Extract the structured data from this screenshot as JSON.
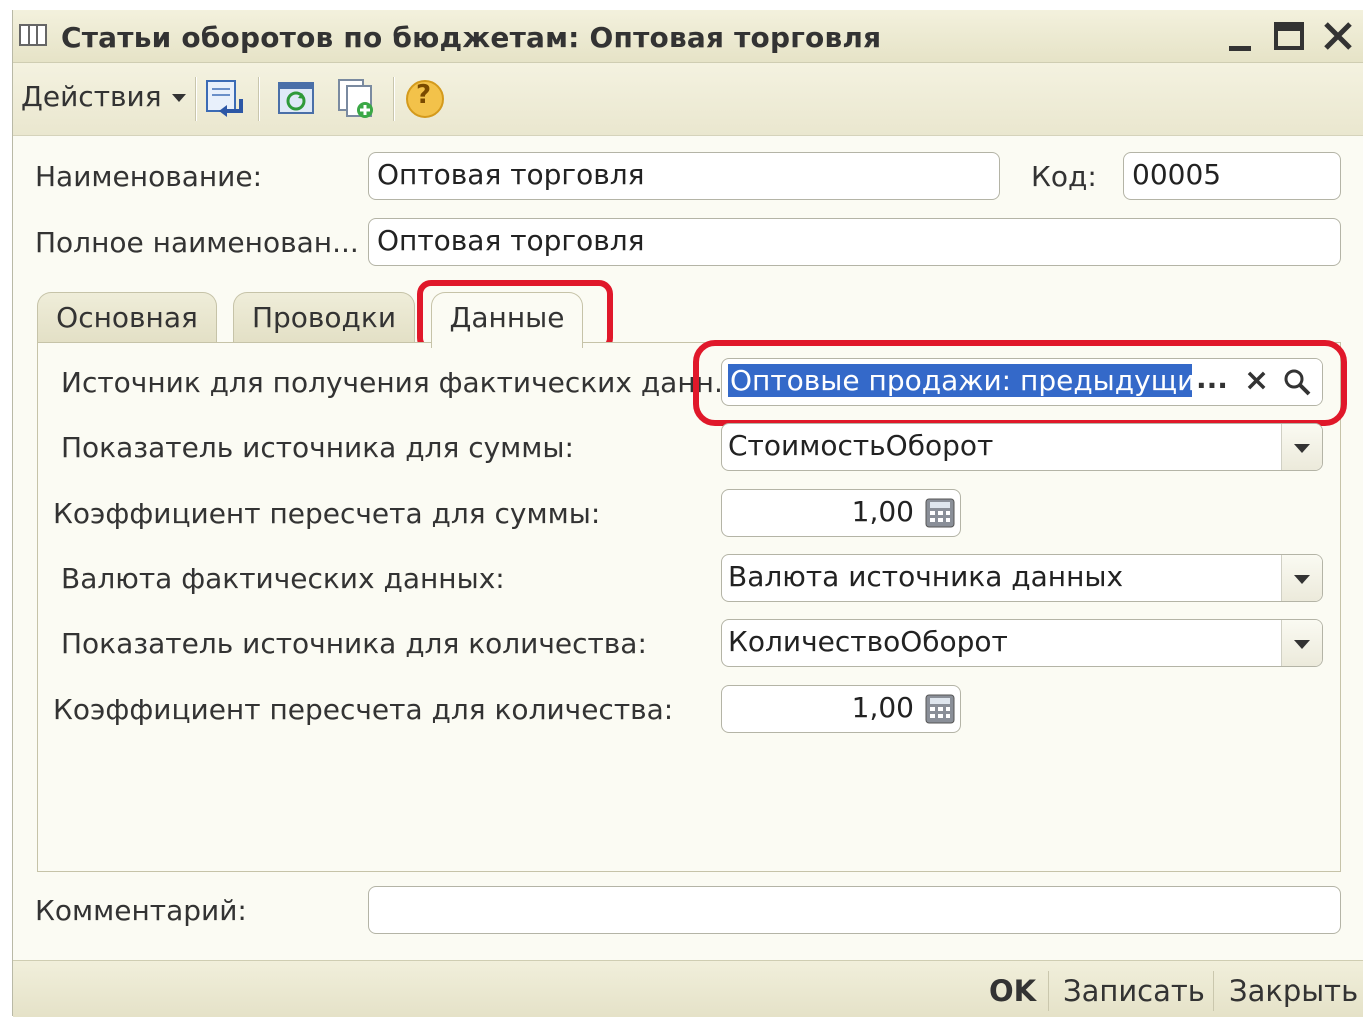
{
  "window": {
    "title": "Статьи оборотов по бюджетам: Оптовая торговля",
    "icon": "table-icon"
  },
  "toolbar": {
    "actions_label": "Действия",
    "icons": [
      "arrow-down-left-icon",
      "refresh-icon",
      "copy-add-icon",
      "help-icon"
    ],
    "help_label": "?"
  },
  "form": {
    "name_label": "Наименование:",
    "name_value": "Оптовая торговля",
    "code_label": "Код:",
    "code_value": "00005",
    "fullname_label": "Полное наименован...",
    "fullname_value": "Оптовая торговля",
    "comment_label": "Комментарий:",
    "comment_value": ""
  },
  "tabs": [
    {
      "label": "Основная",
      "active": false
    },
    {
      "label": "Проводки",
      "active": false
    },
    {
      "label": "Данные",
      "active": true
    }
  ],
  "data_tab": {
    "source_label": "Источник для получения фактических данн...",
    "source_value": "Оптовые продажи: предыдущий м",
    "source_buttons": [
      "...",
      "×",
      "search-icon"
    ],
    "sum_indicator_label": "Показатель источника для суммы:",
    "sum_indicator_value": "СтоимостьОборот",
    "sum_coef_label": "Коэффициент пересчета для суммы:",
    "sum_coef_value": "1,00",
    "currency_label": "Валюта фактических данных:",
    "currency_value": "Валюта источника данных",
    "qty_indicator_label": "Показатель источника для количества:",
    "qty_indicator_value": "КоличествоОборот",
    "qty_coef_label": "Коэффициент пересчета для количества:",
    "qty_coef_value": "1,00"
  },
  "bottom": {
    "ok_label": "OK",
    "save_label": "Записать",
    "close_label": "Закрыть"
  },
  "colors": {
    "highlight_red": "#e0182a",
    "selection_blue": "#3469c9",
    "window_bg": "#fbfbf3"
  }
}
